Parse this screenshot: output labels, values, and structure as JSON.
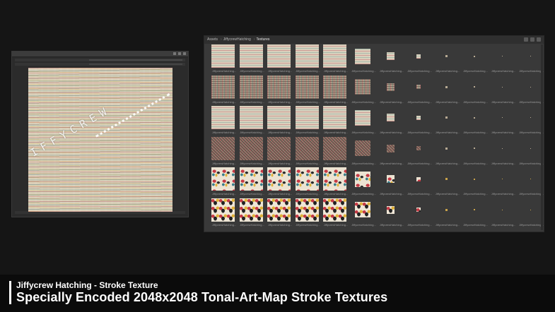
{
  "breadcrumb": [
    "Assets",
    "JiffycrewHatching",
    "Textures"
  ],
  "thumbnail_caption": "JiffycrewHatching...",
  "grid": {
    "rows": [
      "h",
      "x",
      "h",
      "d",
      "b",
      "k"
    ],
    "column_sizes": [
      33,
      33,
      33,
      33,
      33,
      22,
      11,
      6,
      3,
      2,
      1,
      1
    ]
  },
  "footer": {
    "subtitle": "Jiffycrew Hatching - Stroke Texture",
    "title": "Specially Encoded 2048x2048 Tonal-Art-Map Stroke Textures"
  },
  "watermark": "JIFFYCREW",
  "colors": {
    "background": "#151515",
    "panel": "#393939",
    "accent": "#ffffff"
  }
}
